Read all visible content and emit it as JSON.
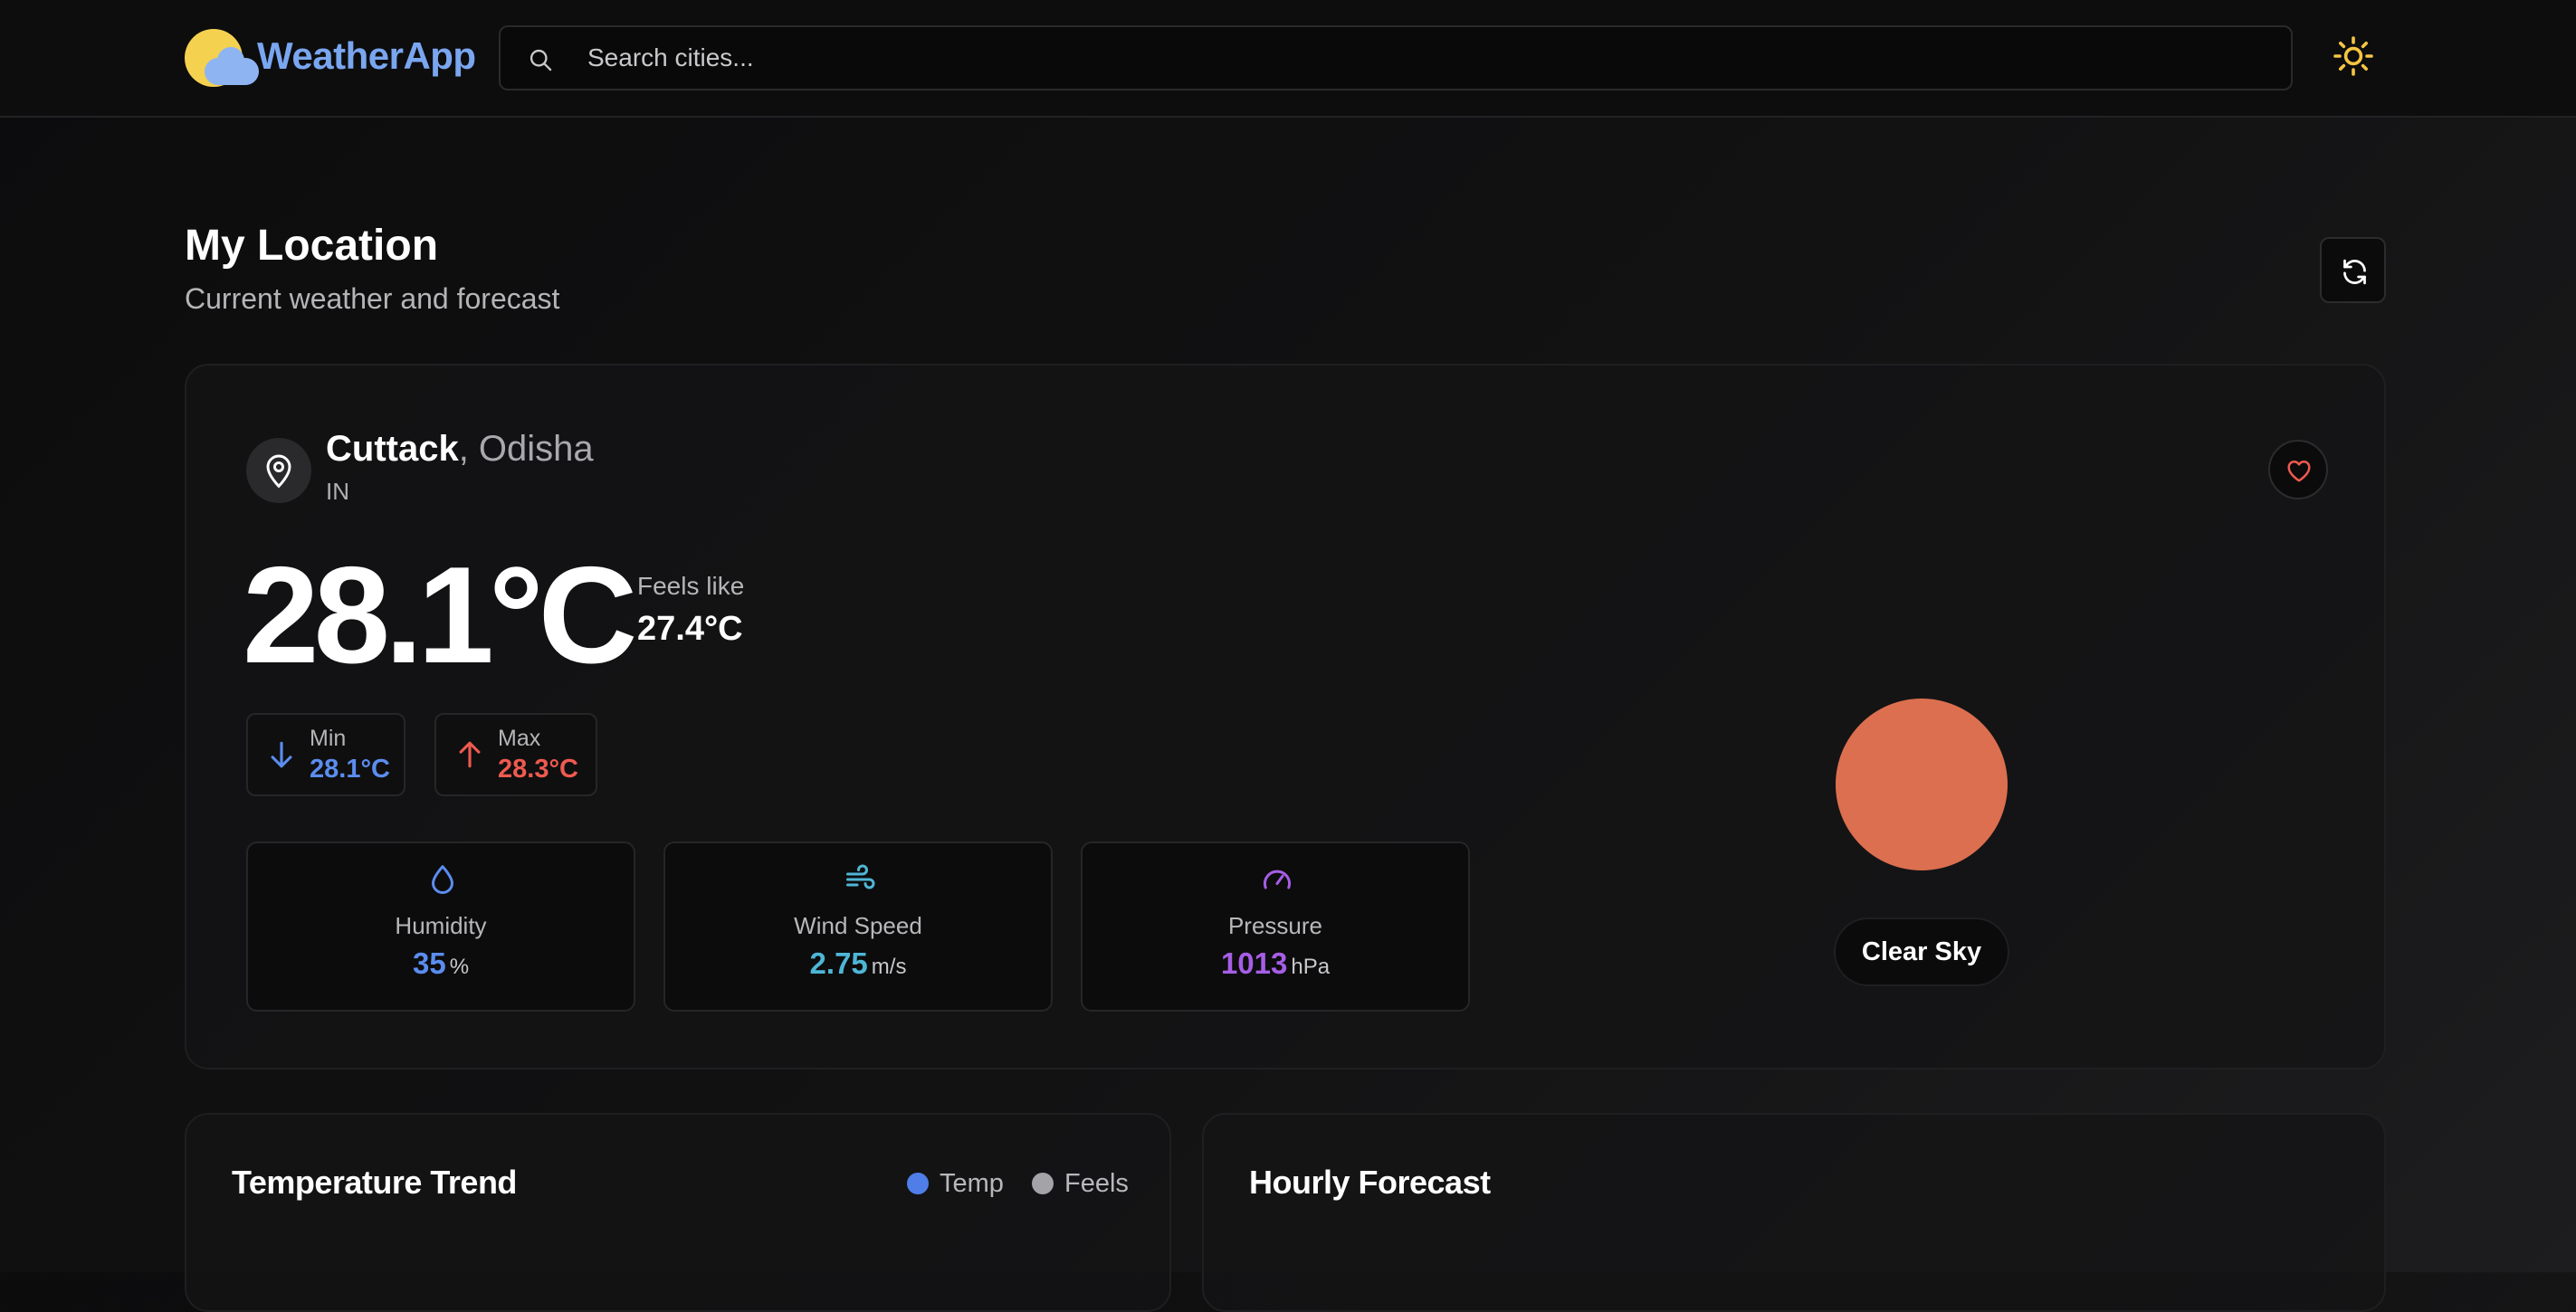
{
  "app": {
    "name": "WeatherApp",
    "search_placeholder": "Search cities..."
  },
  "page": {
    "title": "My Location",
    "subtitle": "Current weather and forecast"
  },
  "location": {
    "city": "Cuttack",
    "region": ", Odisha",
    "country": "IN"
  },
  "current": {
    "temperature": "28.1°C",
    "feels_like_label": "Feels like",
    "feels_like": "27.4°C",
    "min_label": "Min",
    "min": "28.1°C",
    "max_label": "Max",
    "max": "28.3°C",
    "condition": "Clear Sky"
  },
  "stats": [
    {
      "label": "Humidity",
      "value": "35",
      "unit": "%",
      "color": "#5b8def"
    },
    {
      "label": "Wind Speed",
      "value": "2.75",
      "unit": "m/s",
      "color": "#4fb6d6"
    },
    {
      "label": "Pressure",
      "value": "1013",
      "unit": "hPa",
      "color": "#a65ee6"
    }
  ],
  "trend": {
    "title": "Temperature Trend",
    "legend_temp": "Temp",
    "legend_feels": "Feels"
  },
  "hourly": {
    "title": "Hourly Forecast"
  },
  "colors": {
    "accent_blue": "#4f7ee8",
    "min_blue": "#5b8def",
    "max_red": "#ef5a4f",
    "sun": "#dc6f4f",
    "logo": "#7aa6f0"
  },
  "icons": {
    "logo": "sun-cloud-icon",
    "search": "search-icon",
    "theme": "sun-icon",
    "refresh": "refresh-icon",
    "location": "map-pin-icon",
    "favorite": "heart-icon",
    "min": "arrow-down-icon",
    "max": "arrow-up-icon",
    "humidity": "droplet-icon",
    "wind": "wind-icon",
    "pressure": "gauge-icon"
  }
}
